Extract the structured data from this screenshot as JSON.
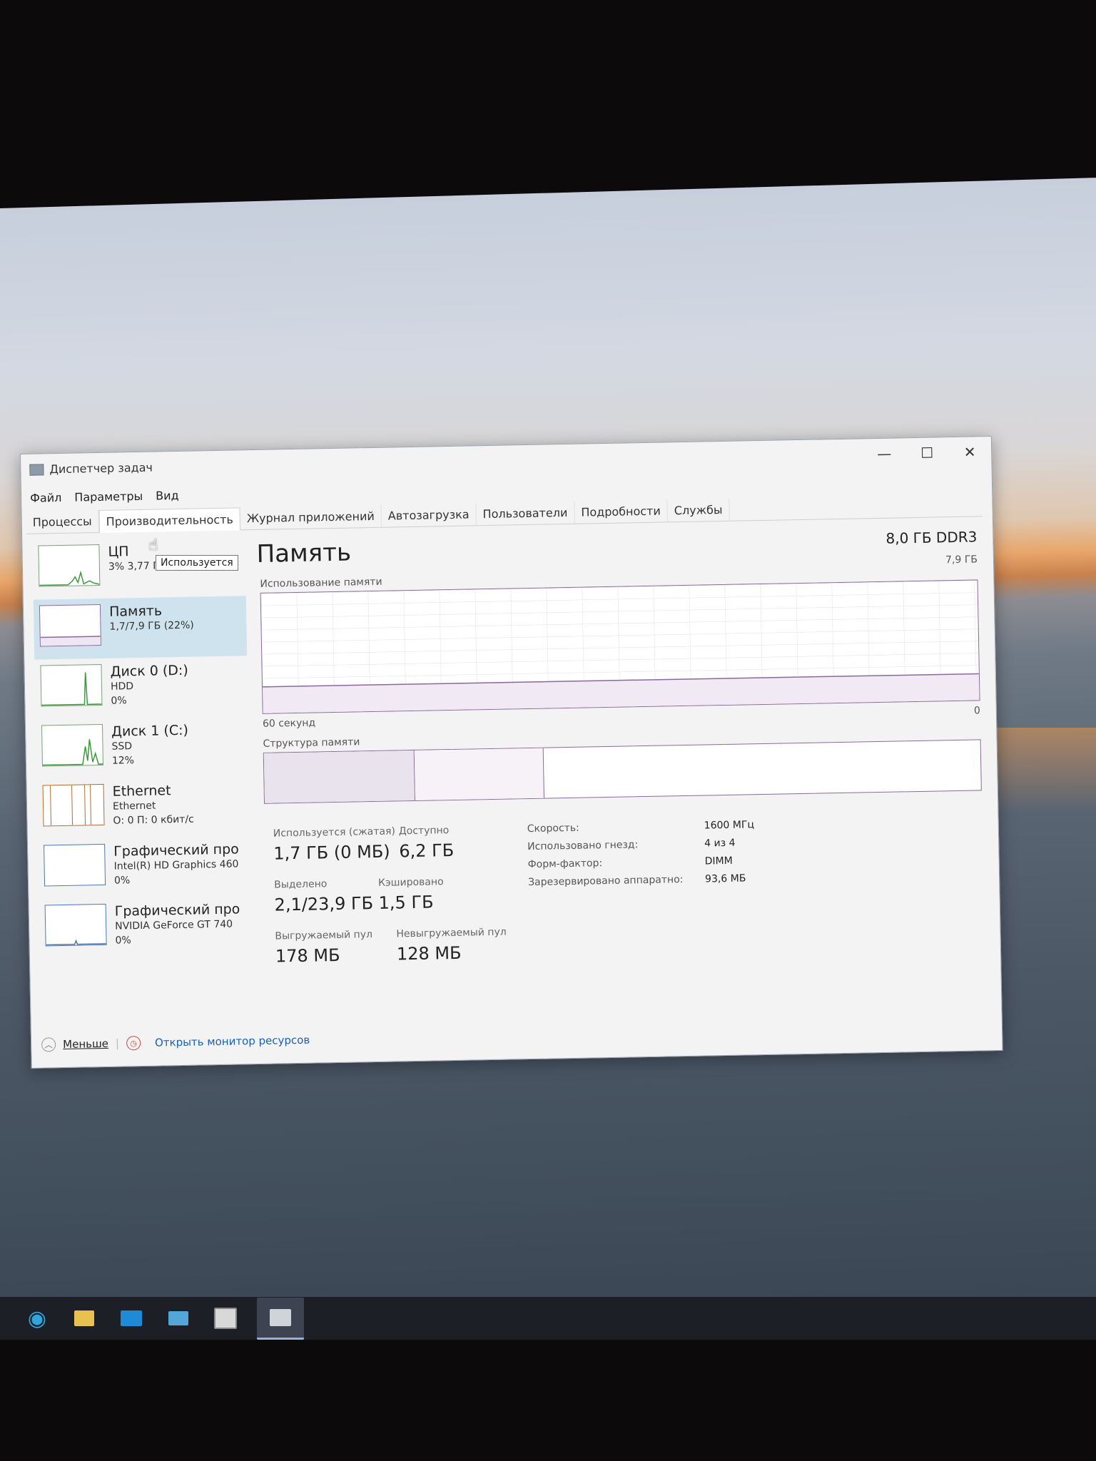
{
  "window": {
    "title": "Диспетчер задач",
    "controls": {
      "minimize": "—",
      "maximize": "☐",
      "close": "✕"
    }
  },
  "menu": [
    "Файл",
    "Параметры",
    "Вид"
  ],
  "tabs": [
    {
      "label": "Процессы",
      "active": false
    },
    {
      "label": "Производительность",
      "active": true
    },
    {
      "label": "Журнал приложений",
      "active": false
    },
    {
      "label": "Автозагрузка",
      "active": false
    },
    {
      "label": "Пользователи",
      "active": false
    },
    {
      "label": "Подробности",
      "active": false
    },
    {
      "label": "Службы",
      "active": false
    }
  ],
  "sidebar": {
    "items": [
      {
        "name": "ЦП",
        "line1": "3% 3,77 ГГц",
        "line2": ""
      },
      {
        "name": "Память",
        "line1": "1,7/7,9 ГБ (22%)",
        "line2": ""
      },
      {
        "name": "Диск 0 (D:)",
        "line1": "HDD",
        "line2": "0%"
      },
      {
        "name": "Диск 1 (C:)",
        "line1": "SSD",
        "line2": "12%"
      },
      {
        "name": "Ethernet",
        "line1": "Ethernet",
        "line2": "О: 0 П: 0 кбит/с"
      },
      {
        "name": "Графический про",
        "line1": "Intel(R) HD Graphics 460",
        "line2": "0%"
      },
      {
        "name": "Графический про",
        "line1": "NVIDIA GeForce GT 740",
        "line2": "0%"
      }
    ]
  },
  "tooltip": "Используется",
  "memory": {
    "title": "Память",
    "spec": "8,0 ГБ DDR3",
    "max": "7,9 ГБ",
    "usage_label": "Использование памяти",
    "axis_left": "60 секунд",
    "axis_right": "0",
    "structure_label": "Структура памяти",
    "usage_fraction": 0.22,
    "stats": {
      "in_use_label": "Используется (сжатая)",
      "in_use_value": "1,7 ГБ (0 МБ)",
      "available_label": "Доступно",
      "available_value": "6,2 ГБ",
      "committed_label": "Выделено",
      "committed_value": "2,1/23,9 ГБ",
      "cached_label": "Кэшировано",
      "cached_value": "1,5 ГБ",
      "paged_label": "Выгружаемый пул",
      "paged_value": "178 МБ",
      "nonpaged_label": "Невыгружаемый пул",
      "nonpaged_value": "128 МБ"
    },
    "specs": [
      {
        "key": "Скорость:",
        "value": "1600 МГц"
      },
      {
        "key": "Использовано гнезд:",
        "value": "4 из 4"
      },
      {
        "key": "Форм-фактор:",
        "value": "DIMM"
      },
      {
        "key": "Зарезервировано аппаратно:",
        "value": "93,6 МБ"
      }
    ]
  },
  "footer": {
    "fewer": "Меньше",
    "monitor": "Открыть монитор ресурсов"
  },
  "colors": {
    "memory_accent": "#8a6a9a",
    "cpu_accent": "#3c9a3c",
    "selected_bg": "#cfe3ee"
  }
}
